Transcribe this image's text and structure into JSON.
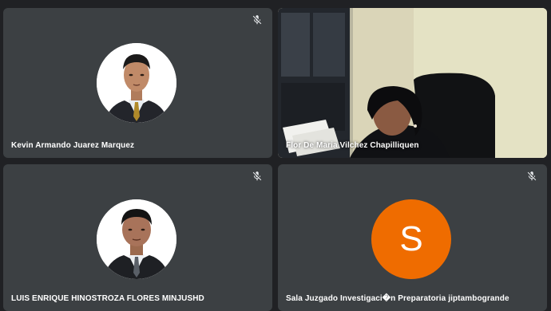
{
  "participants": [
    {
      "name": "Kevin Armando Juarez Marquez",
      "muted": true,
      "icon": "mic-off-icon"
    },
    {
      "name": "Flor De Maria Vilchez Chapilliquen",
      "muted": false
    },
    {
      "name": "LUIS ENRIQUE HINOSTROZA FLORES MINJUSHD",
      "muted": true,
      "icon": "mic-off-icon"
    },
    {
      "name": "Sala Juzgado Investigaci�n Preparatoria jiptambogrande",
      "muted": true,
      "icon": "mic-off-icon",
      "avatar_letter": "S",
      "avatar_color": "#ef6c00"
    }
  ],
  "colors": {
    "background": "#202124",
    "tile": "#3c4043",
    "accent_avatar": "#ef6c00"
  }
}
